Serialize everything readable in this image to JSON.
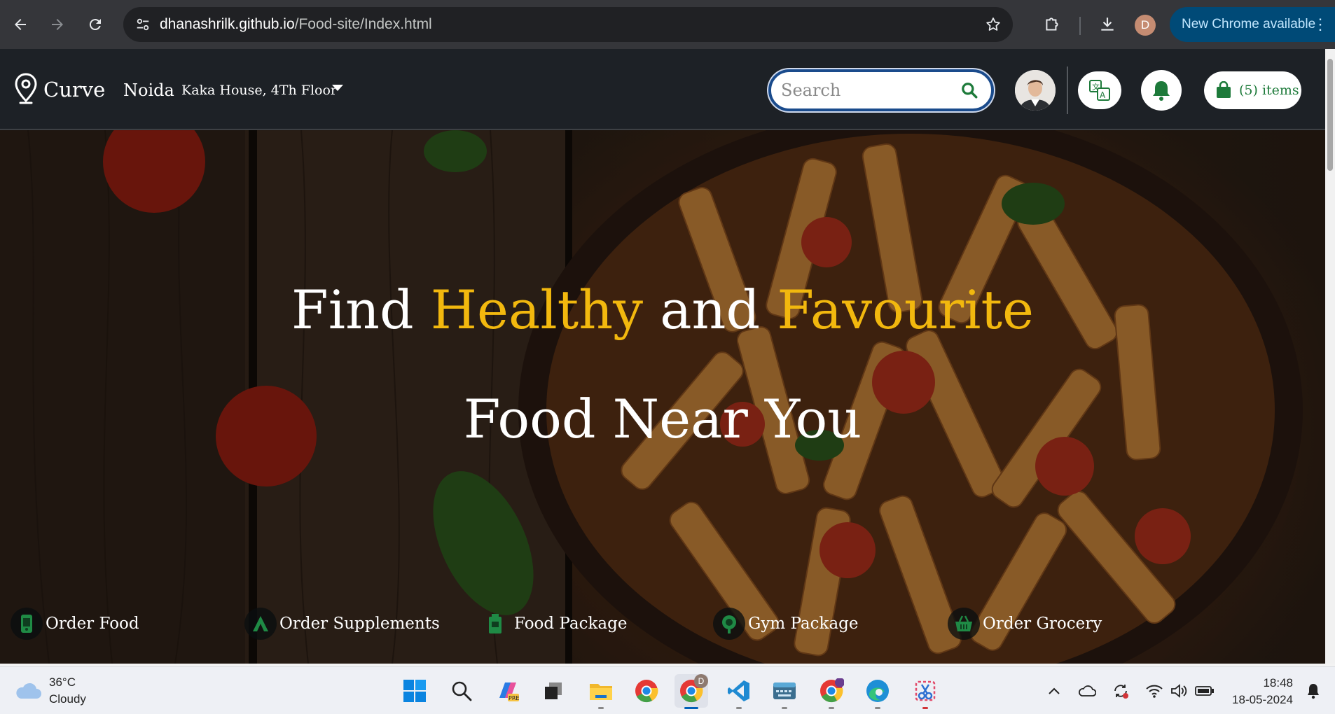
{
  "browser": {
    "url_host": "dhanashrilk.github.io",
    "url_path": "/Food-site/Index.html",
    "profile_initial": "D",
    "update_label": "New Chrome available"
  },
  "header": {
    "logo_text": "Curve",
    "city": "Noida",
    "address": "Kaka House, 4Th Floor",
    "search_placeholder": "Search",
    "cart_label": "(5) items",
    "brand_green": "#1d7a3a"
  },
  "hero": {
    "line1_part1": "Find ",
    "line1_highlight1": "Healthy",
    "line1_part2": " and ",
    "line1_highlight2": "Favourite",
    "line2": "Food Near You",
    "highlight_color": "#f2b80e"
  },
  "services": [
    {
      "label": "Order Food",
      "icon": "phone-order-icon"
    },
    {
      "label": "Order Supplements",
      "icon": "supplement-icon"
    },
    {
      "label": "Food Package",
      "icon": "food-package-icon"
    },
    {
      "label": "Gym Package",
      "icon": "gym-package-icon"
    },
    {
      "label": "Order Grocery",
      "icon": "grocery-basket-icon"
    }
  ],
  "taskbar": {
    "temperature": "36°C",
    "weather": "Cloudy",
    "time": "18:48",
    "date": "18-05-2024",
    "chrome_badge": "D"
  }
}
